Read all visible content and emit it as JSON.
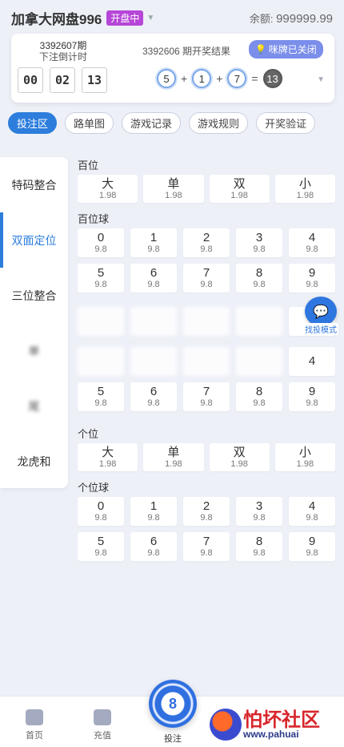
{
  "header": {
    "title": "加拿大网盘996",
    "status": "开盘中",
    "balance_label": "余额:",
    "balance_value": "999999.99"
  },
  "draw": {
    "period": "3392607期",
    "countdown_label": "下注倒计时",
    "timer": [
      "00",
      "02",
      "13"
    ],
    "result_label": "3392606 期开奖结果",
    "closed_label": "咪牌已关闭",
    "balls": [
      "5",
      "1",
      "7"
    ],
    "sum": "13",
    "plus": "+",
    "equals": "="
  },
  "tabs": [
    "投注区",
    "路单图",
    "游戏记录",
    "游戏规则",
    "开奖验证"
  ],
  "sidebar": [
    "特码整合",
    "双面定位",
    "三位整合",
    "单",
    "尾",
    "龙虎和"
  ],
  "sections": {
    "hundreds_title": "百位",
    "hundreds_ball_title": "百位球",
    "units_title": "个位",
    "units_ball_title": "个位球"
  },
  "two_sided": [
    {
      "label": "大",
      "odds": "1.98"
    },
    {
      "label": "单",
      "odds": "1.98"
    },
    {
      "label": "双",
      "odds": "1.98"
    },
    {
      "label": "小",
      "odds": "1.98"
    }
  ],
  "ball_row1": [
    {
      "label": "0",
      "odds": "9.8"
    },
    {
      "label": "1",
      "odds": "9.8"
    },
    {
      "label": "2",
      "odds": "9.8"
    },
    {
      "label": "3",
      "odds": "9.8"
    },
    {
      "label": "4",
      "odds": "9.8"
    }
  ],
  "ball_row2": [
    {
      "label": "5",
      "odds": "9.8"
    },
    {
      "label": "6",
      "odds": "9.8"
    },
    {
      "label": "7",
      "odds": "9.8"
    },
    {
      "label": "8",
      "odds": "9.8"
    },
    {
      "label": "9",
      "odds": "9.8"
    }
  ],
  "obscured": {
    "cell_a_odds": "8",
    "cell_b_label": "4"
  },
  "float_button": {
    "label": "找投模式"
  },
  "bottom_nav": {
    "home": "首页",
    "recharge": "充值",
    "bet": "投注",
    "bet_glyph": "8"
  },
  "watermark": {
    "title": "怕坏社区",
    "url": "www.pahuai"
  }
}
